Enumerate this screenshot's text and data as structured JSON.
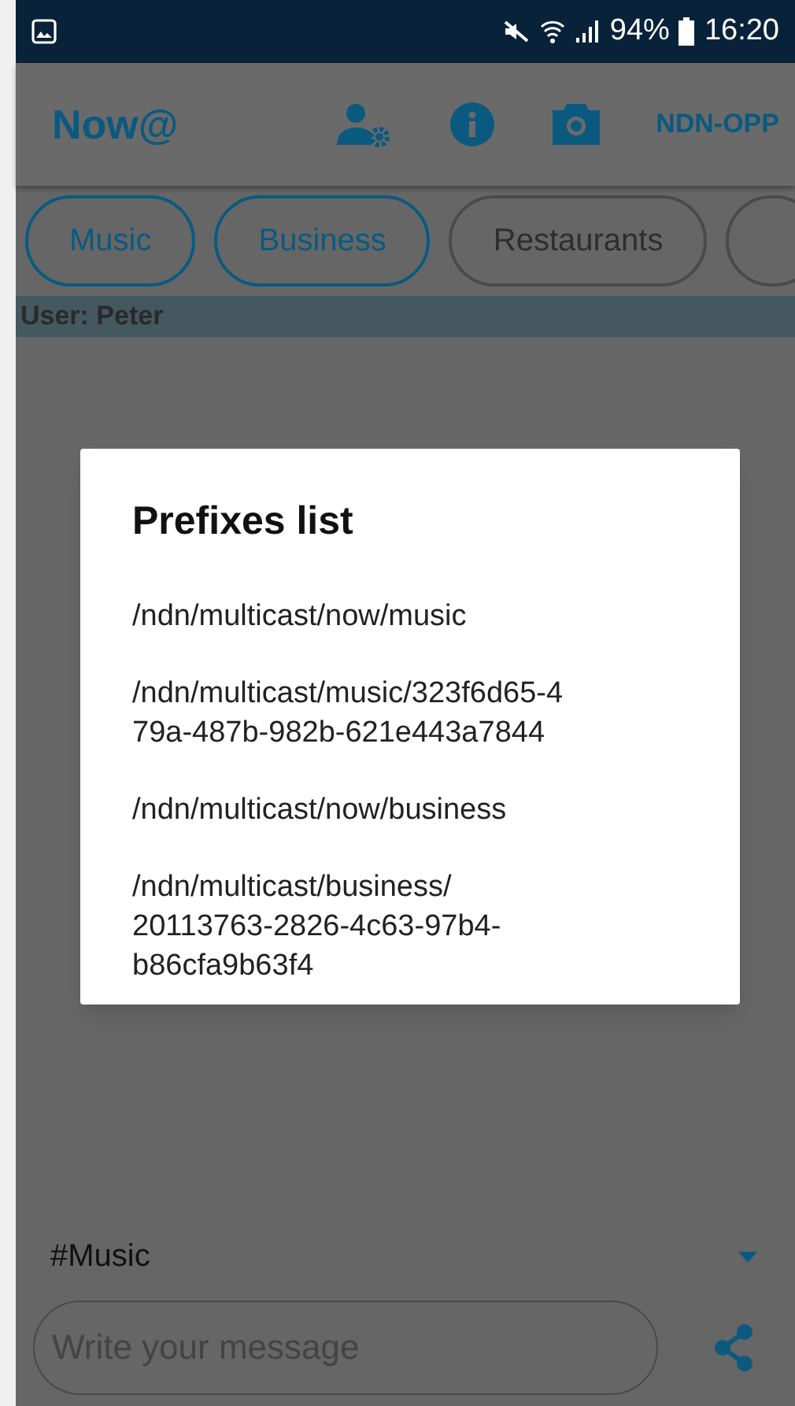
{
  "status_bar": {
    "battery": "94%",
    "time": "16:20"
  },
  "app_bar": {
    "title": "Now@",
    "action": "NDN-OPP"
  },
  "chips": [
    {
      "label": "Music",
      "selected": true
    },
    {
      "label": "Business",
      "selected": true
    },
    {
      "label": "Restaurants",
      "selected": false
    }
  ],
  "user_bar": {
    "label": "User: Peter"
  },
  "dialog": {
    "title": "Prefixes list",
    "prefixes": [
      {
        "lines": [
          "/ndn/multicast/now/music"
        ]
      },
      {
        "lines": [
          "/ndn/multicast/music/323f6d65-4",
          "79a-487b-982b-621e443a7844"
        ]
      },
      {
        "lines": [
          "/ndn/multicast/now/business"
        ]
      },
      {
        "lines": [
          "/ndn/multicast/business/",
          "20113763-2826-4c63-97b4-",
          "b86cfa9b63f4"
        ]
      }
    ]
  },
  "channel_select": {
    "value": "#Music"
  },
  "message": {
    "placeholder": "Write your message"
  }
}
